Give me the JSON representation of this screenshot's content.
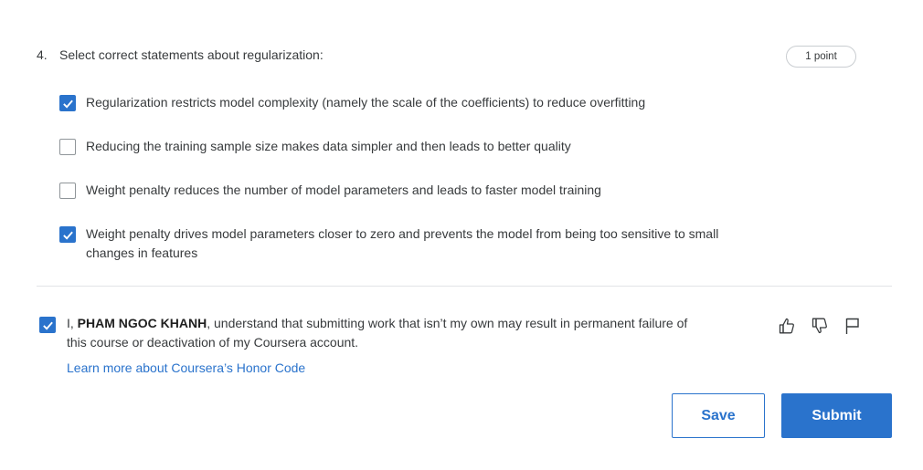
{
  "question": {
    "number": "4.",
    "text": "Select correct statements about regularization:",
    "points": "1 point",
    "options": [
      {
        "label": "Regularization restricts model complexity (namely the scale of the coefficients) to reduce overfitting",
        "checked": true
      },
      {
        "label": "Reducing the training sample size makes data simpler and then leads to better quality",
        "checked": false
      },
      {
        "label": "Weight penalty reduces the number of model parameters and leads to faster model training",
        "checked": false
      },
      {
        "label": "Weight penalty drives model parameters closer to zero and prevents the model from being too sensitive to small changes in features",
        "checked": true
      }
    ]
  },
  "honor": {
    "prefix": "I, ",
    "name": "PHAM NGOC KHANH",
    "suffix": ", understand that submitting work that isn’t my own may result in permanent failure of this course or deactivation of my Coursera account.",
    "checked": true,
    "link": "Learn more about Coursera’s Honor Code"
  },
  "feedback": {
    "icons": [
      "thumbs-up-icon",
      "thumbs-down-icon",
      "flag-icon"
    ]
  },
  "actions": {
    "save_label": "Save",
    "submit_label": "Submit"
  },
  "colors": {
    "accent": "#2a73cc",
    "text": "#373a3c",
    "divider": "#e2e4e6"
  }
}
